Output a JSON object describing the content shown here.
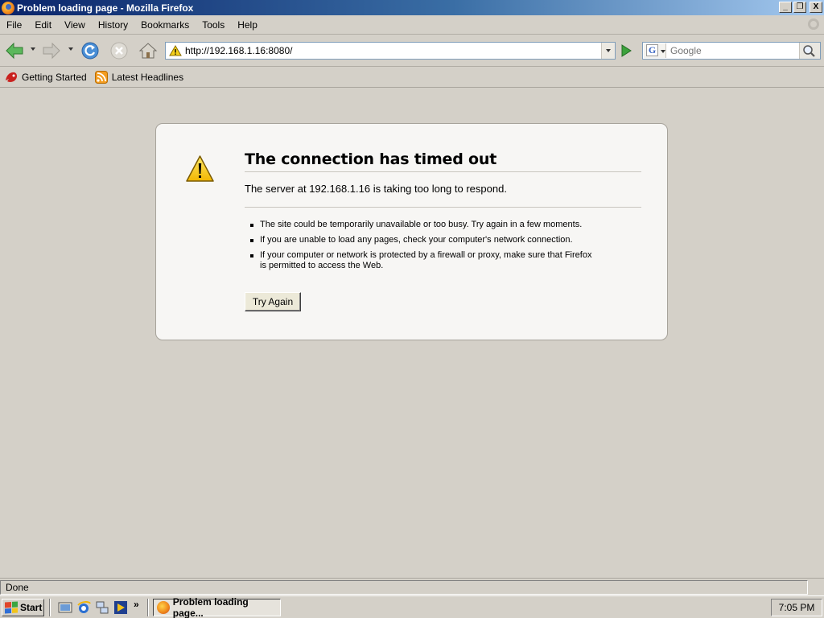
{
  "window": {
    "title": "Problem loading page - Mozilla Firefox",
    "icon": "firefox-icon",
    "minimize_label": "_",
    "restore_label": "❐",
    "close_label": "X"
  },
  "menu": {
    "items": [
      "File",
      "Edit",
      "View",
      "History",
      "Bookmarks",
      "Tools",
      "Help"
    ]
  },
  "navigation": {
    "back_icon": "back-arrow-icon",
    "forward_icon": "forward-arrow-icon",
    "reload_icon": "reload-icon",
    "stop_icon": "stop-icon",
    "home_icon": "home-icon",
    "url": "http://192.168.1.16:8080/",
    "url_icon": "warning-icon",
    "go_icon": "go-arrow-icon"
  },
  "search": {
    "engine_icon": "google-icon",
    "engine_letter": "G",
    "placeholder": "Google"
  },
  "bookmarks": {
    "items": [
      {
        "label": "Getting Started",
        "icon": "firefox-icon"
      },
      {
        "label": "Latest Headlines",
        "icon": "rss-feed-icon"
      }
    ]
  },
  "error": {
    "icon": "warning-icon",
    "title": "The connection has timed out",
    "description": "The server at 192.168.1.16 is taking too long to respond.",
    "bullets": [
      "The site could be temporarily unavailable or too busy. Try again in a few moments.",
      "If you are unable to load any pages, check your computer's network connection.",
      "If your computer or network is protected by a firewall or proxy, make sure that Firefox is permitted to access the Web."
    ],
    "button_label": "Try Again"
  },
  "status": {
    "text": "Done"
  },
  "taskbar": {
    "start_label": "Start",
    "quicklaunch_icons": [
      "show-desktop-icon",
      "internet-explorer-icon",
      "network-icon",
      "media-player-icon"
    ],
    "overflow_label": "»",
    "active_task": "Problem loading page...",
    "clock": "7:05 PM"
  },
  "colors": {
    "titlebar_start": "#0a246a",
    "titlebar_end": "#a6caf0",
    "chrome_bg": "#d4d0c8",
    "error_box_bg": "#f7f6f4",
    "go_green": "#3ca23c"
  }
}
